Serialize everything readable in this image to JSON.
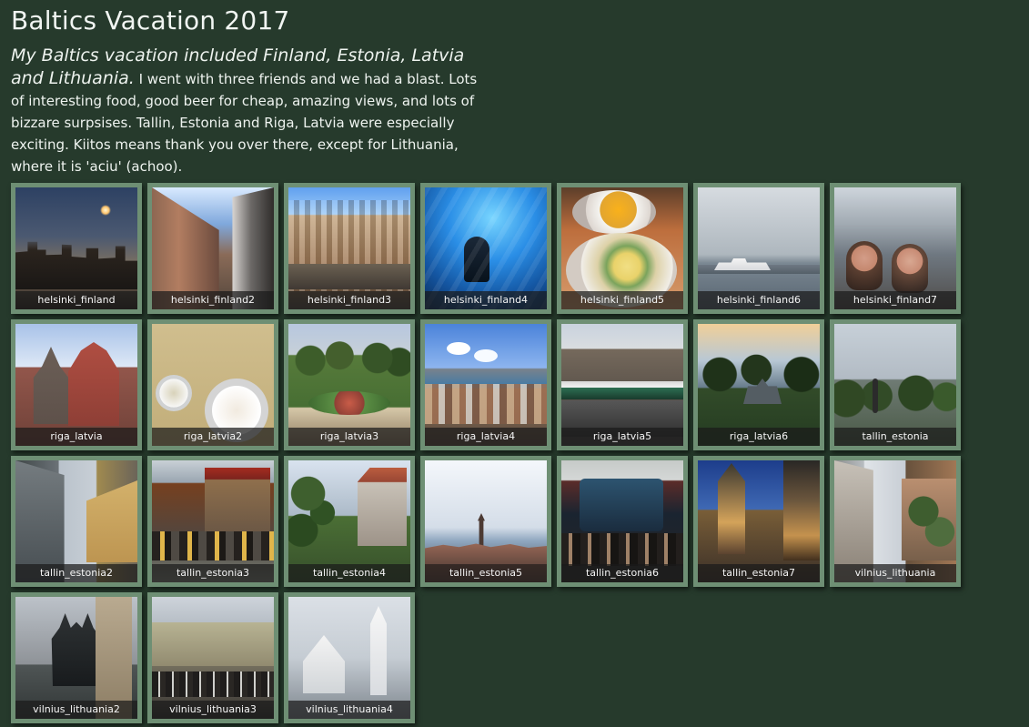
{
  "page": {
    "title": "Baltics Vacation 2017",
    "intro_lead": "My Baltics vacation included Finland, Estonia, Latvia and Lithuania.",
    "intro_text": " I went with three friends and we had a blast. Lots of interesting food, good beer for cheap, amazing views, and lots of bizzare surpsises. Tallin, Estonia and Riga, Latvia were especially exciting. Kiitos means thank you over there, except for Lithuania, where it is 'aciu' (achoo)."
  },
  "gallery": {
    "tiles": [
      {
        "caption": "helsinki_finland"
      },
      {
        "caption": "helsinki_finland2"
      },
      {
        "caption": "helsinki_finland3"
      },
      {
        "caption": "helsinki_finland4"
      },
      {
        "caption": "helsinki_finland5"
      },
      {
        "caption": "helsinki_finland6"
      },
      {
        "caption": "helsinki_finland7"
      },
      {
        "caption": "riga_latvia"
      },
      {
        "caption": "riga_latvia2"
      },
      {
        "caption": "riga_latvia3"
      },
      {
        "caption": "riga_latvia4"
      },
      {
        "caption": "riga_latvia5"
      },
      {
        "caption": "riga_latvia6"
      },
      {
        "caption": "tallin_estonia"
      },
      {
        "caption": "tallin_estonia2"
      },
      {
        "caption": "tallin_estonia3"
      },
      {
        "caption": "tallin_estonia4"
      },
      {
        "caption": "tallin_estonia5"
      },
      {
        "caption": "tallin_estonia6"
      },
      {
        "caption": "tallin_estonia7"
      },
      {
        "caption": "vilnius_lithuania"
      },
      {
        "caption": "vilnius_lithuania2"
      },
      {
        "caption": "vilnius_lithuania3"
      },
      {
        "caption": "vilnius_lithuania4"
      }
    ]
  },
  "theme": {
    "background": "#263a2c",
    "frame": "#6e8f74",
    "text": "#eef3ef"
  }
}
